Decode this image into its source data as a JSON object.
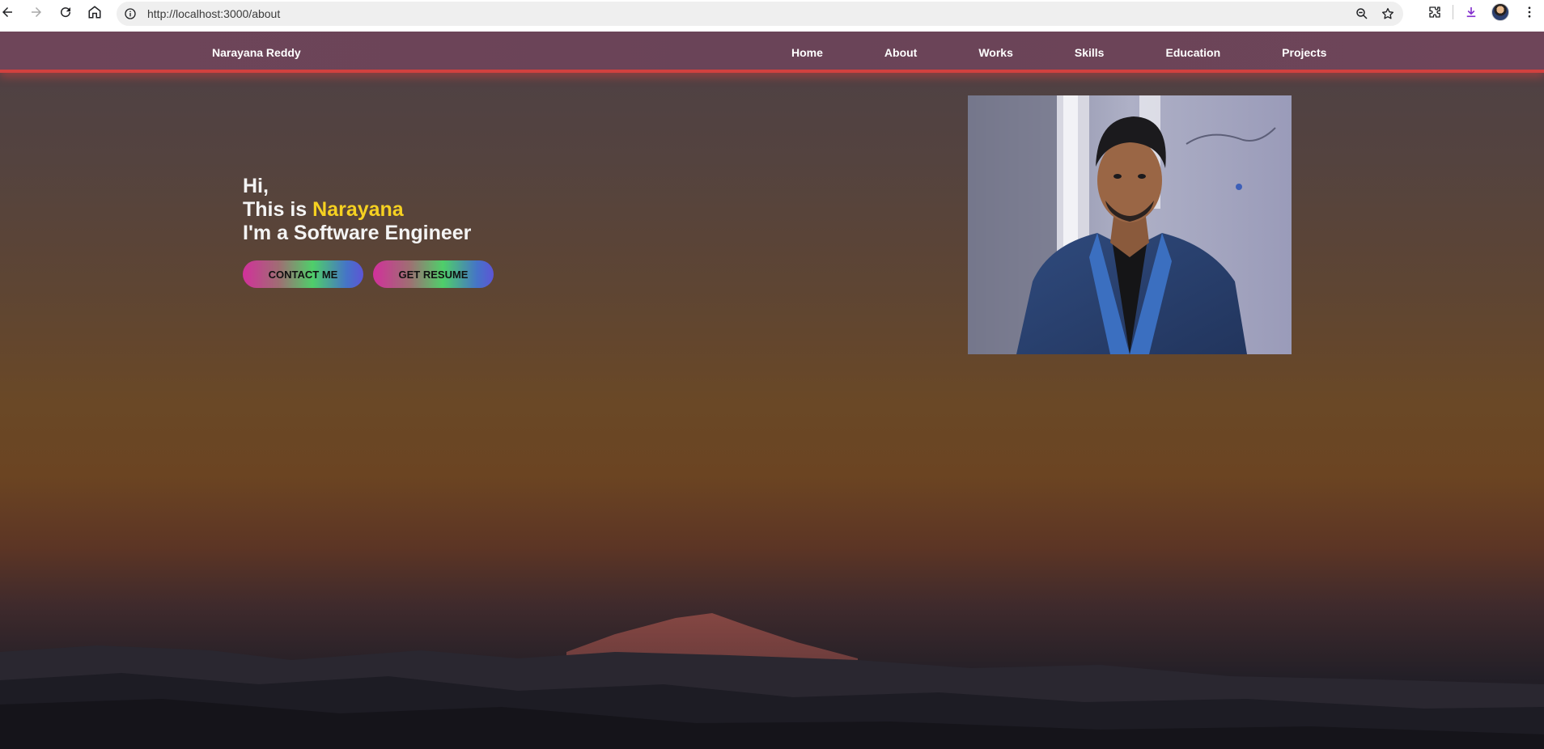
{
  "browser": {
    "url": "http://localhost:3000/about",
    "icons": [
      "back-arrow-icon",
      "forward-arrow-icon",
      "reload-icon",
      "home-icon",
      "site-info-icon",
      "zoom-icon",
      "bookmark-star-icon",
      "extensions-icon",
      "download-icon",
      "profile-avatar",
      "menu-kebab-icon"
    ]
  },
  "site_nav": {
    "brand": "Narayana Reddy",
    "links": [
      "Home",
      "About",
      "Works",
      "Skills",
      "Education",
      "Projects"
    ]
  },
  "hero": {
    "line1": "Hi,",
    "line2_prefix": "This is ",
    "line2_name": "Narayana",
    "line3": "I'm a Software Engineer",
    "contact_button": "CONTACT ME",
    "resume_button": "GET RESUME"
  },
  "colors": {
    "highlight": "#f5d121",
    "nav_accent": "#d2413f",
    "nav_background": "#6a4458"
  }
}
